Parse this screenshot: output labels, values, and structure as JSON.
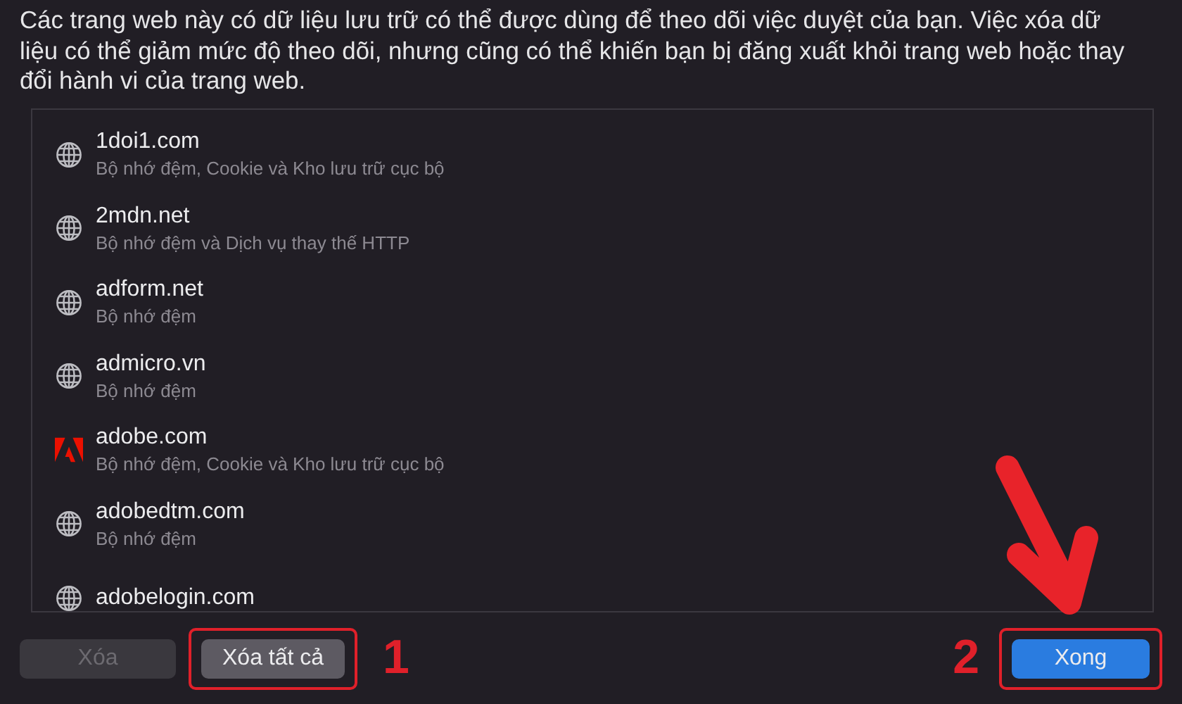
{
  "description": "Các trang web này có dữ liệu lưu trữ có thể được dùng để theo dõi việc duyệt của bạn. Việc xóa dữ liệu có thể giảm mức độ theo dõi, nhưng cũng có thể khiến bạn bị đăng xuất khỏi trang web hoặc thay đổi hành vi của trang web.",
  "sites": [
    {
      "domain": "1doi1.com",
      "detail": "Bộ nhớ đệm, Cookie và Kho lưu trữ cục bộ",
      "kind": "globe"
    },
    {
      "domain": "2mdn.net",
      "detail": "Bộ nhớ đệm và Dịch vụ thay thế HTTP",
      "kind": "globe"
    },
    {
      "domain": "adform.net",
      "detail": "Bộ nhớ đệm",
      "kind": "globe"
    },
    {
      "domain": "admicro.vn",
      "detail": "Bộ nhớ đệm",
      "kind": "globe"
    },
    {
      "domain": "adobe.com",
      "detail": "Bộ nhớ đệm, Cookie và Kho lưu trữ cục bộ",
      "kind": "adobe"
    },
    {
      "domain": "adobedtm.com",
      "detail": "Bộ nhớ đệm",
      "kind": "globe"
    },
    {
      "domain": "adobelogin.com",
      "kind": "globe"
    }
  ],
  "buttons": [
    {
      "label": "Xóa",
      "disabled": true,
      "highlighted": false
    },
    {
      "label": "Xóa tất cả",
      "disabled": false,
      "highlighted": true,
      "step": "1"
    }
  ],
  "done_button": {
    "label": "Xong",
    "highlighted": true,
    "step": "2"
  }
}
